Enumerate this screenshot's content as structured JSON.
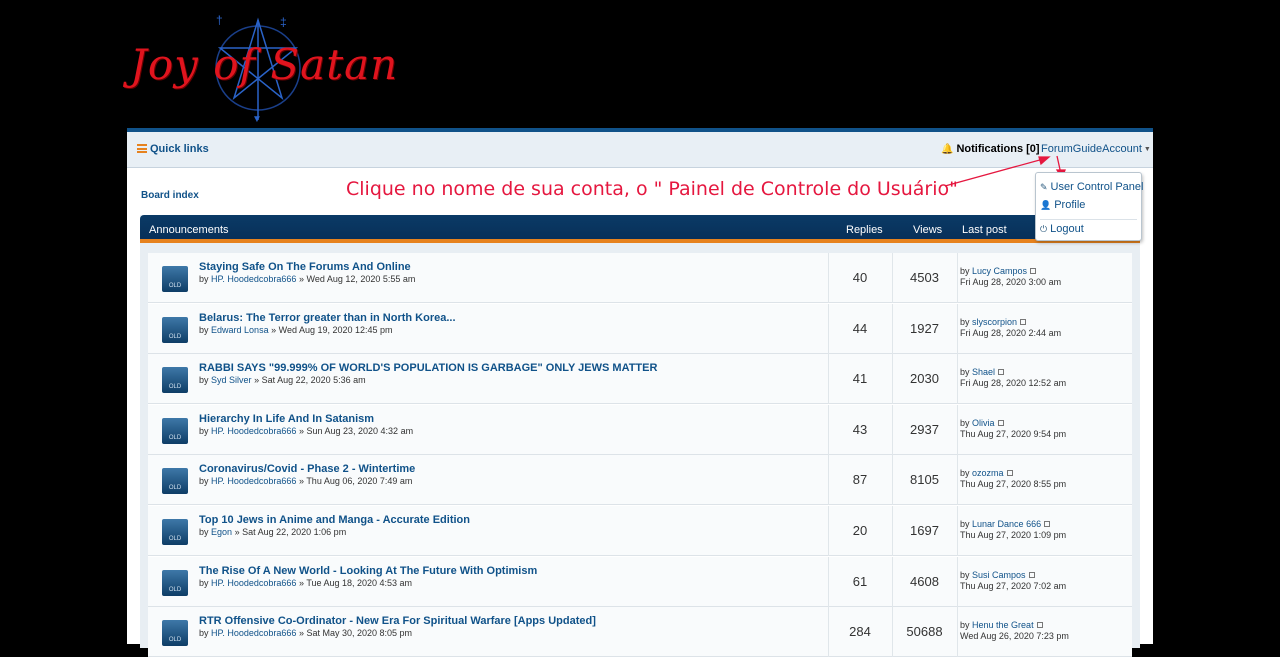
{
  "logo": {
    "text": "Joy of Satan"
  },
  "navbar": {
    "quick_links": "Quick links",
    "notifications": "Notifications [0]",
    "account": "ForumGuideAccount"
  },
  "dropdown": {
    "items": [
      "User Control Panel",
      "Profile",
      "Logout"
    ]
  },
  "breadcrumb": "Board index",
  "annotation": "Clique no nome de sua conta, o \" Painel de Controle do Usuário\"",
  "table": {
    "headers": {
      "title": "Announcements",
      "replies": "Replies",
      "views": "Views",
      "last_post": "Last post"
    },
    "icon_label": "OLD",
    "rows": [
      {
        "title": "Staying Safe On The Forums And Online",
        "author": "HP. Hoodedcobra666",
        "date": "Wed Aug 12, 2020 5:55 am",
        "replies": "40",
        "views": "4503",
        "last_by": "Lucy Campos",
        "last_date": "Fri Aug 28, 2020 3:00 am"
      },
      {
        "title": "Belarus: The Terror greater than in North Korea...",
        "author": "Edward Lonsa",
        "date": "Wed Aug 19, 2020 12:45 pm",
        "replies": "44",
        "views": "1927",
        "last_by": "slyscorpion",
        "last_date": "Fri Aug 28, 2020 2:44 am"
      },
      {
        "title": "RABBI SAYS \"99.999% OF WORLD'S POPULATION IS GARBAGE\" ONLY JEWS MATTER",
        "author": "Syd Silver",
        "date": "Sat Aug 22, 2020 5:36 am",
        "replies": "41",
        "views": "2030",
        "last_by": "Shael",
        "last_date": "Fri Aug 28, 2020 12:52 am"
      },
      {
        "title": "Hierarchy In Life And In Satanism",
        "author": "HP. Hoodedcobra666",
        "date": "Sun Aug 23, 2020 4:32 am",
        "replies": "43",
        "views": "2937",
        "last_by": "Olivia",
        "last_date": "Thu Aug 27, 2020 9:54 pm"
      },
      {
        "title": "Coronavirus/Covid - Phase 2 - Wintertime",
        "author": "HP. Hoodedcobra666",
        "date": "Thu Aug 06, 2020 7:49 am",
        "replies": "87",
        "views": "8105",
        "last_by": "ozozma",
        "last_date": "Thu Aug 27, 2020 8:55 pm"
      },
      {
        "title": "Top 10 Jews in Anime and Manga - Accurate Edition",
        "author": "Egon",
        "date": "Sat Aug 22, 2020 1:06 pm",
        "replies": "20",
        "views": "1697",
        "last_by": "Lunar Dance 666",
        "last_date": "Thu Aug 27, 2020 1:09 pm"
      },
      {
        "title": "The Rise Of A New World - Looking At The Future With Optimism",
        "author": "HP. Hoodedcobra666",
        "date": "Tue Aug 18, 2020 4:53 am",
        "replies": "61",
        "views": "4608",
        "last_by": "Susi Campos",
        "last_date": "Thu Aug 27, 2020 7:02 am"
      },
      {
        "title": "RTR Offensive Co-Ordinator - New Era For Spiritual Warfare [Apps Updated]",
        "author": "HP. Hoodedcobra666",
        "date": "Sat May 30, 2020 8:05 pm",
        "replies": "284",
        "views": "50688",
        "last_by": "Henu the Great",
        "last_date": "Wed Aug 26, 2020 7:23 pm"
      }
    ]
  },
  "labels": {
    "by": "by",
    "sep": "»"
  },
  "colors": {
    "brand": "#105289",
    "accent": "#e6821e",
    "annotation": "#e5173f"
  }
}
